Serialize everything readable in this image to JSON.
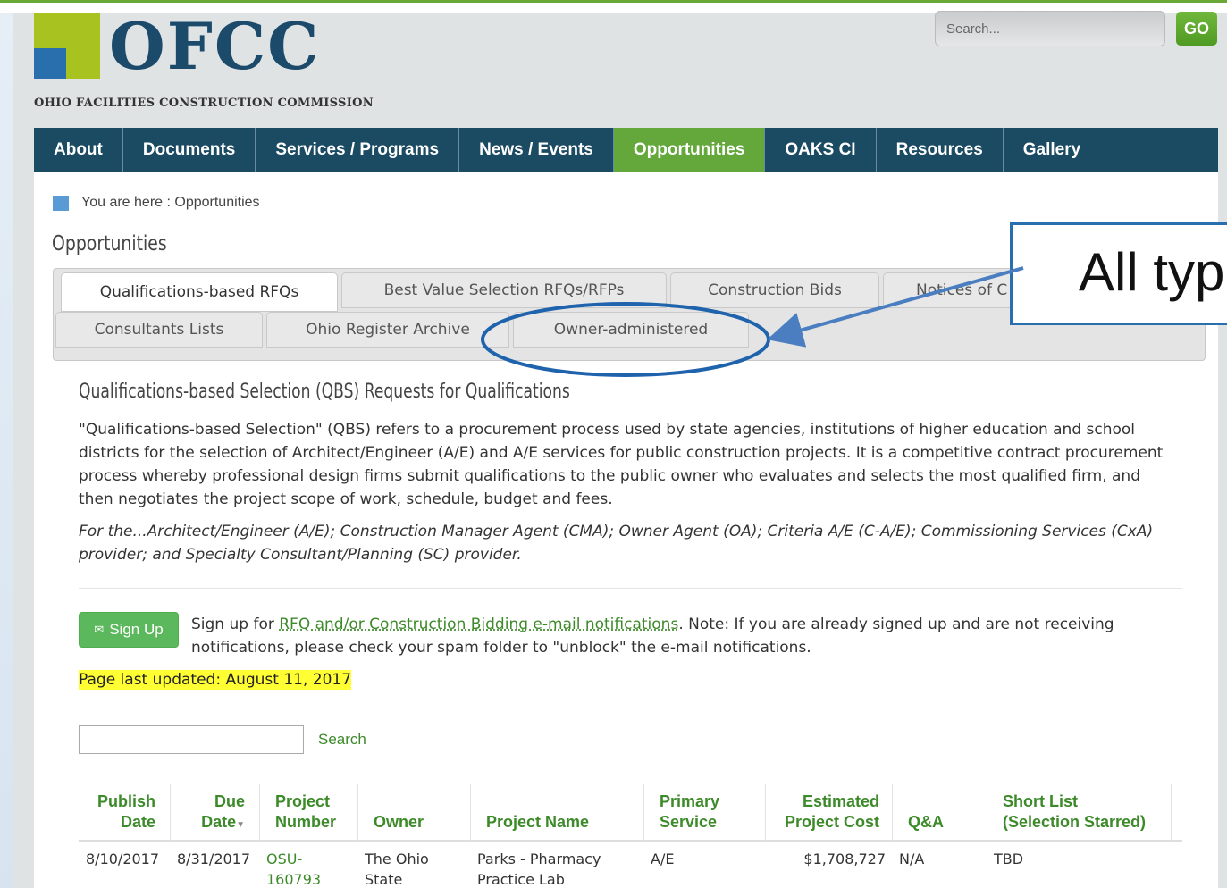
{
  "header": {
    "logo_text": "OFCC",
    "logo_subtitle": "OHIO FACILITIES CONSTRUCTION COMMISSION",
    "search_placeholder": "Search...",
    "search_button": "GO"
  },
  "nav": {
    "items": [
      "About",
      "Documents",
      "Services / Programs",
      "News / Events",
      "Opportunities",
      "OAKS CI",
      "Resources",
      "Gallery"
    ],
    "active": "Opportunities"
  },
  "breadcrumb": "You are here : Opportunities",
  "page_title": "Opportunities",
  "tabs": {
    "row1": [
      "Qualifications-based RFQs",
      "Best Value Selection RFQs/RFPs",
      "Construction Bids",
      "Notices of C"
    ],
    "row2": [
      "Consultants Lists",
      "Ohio Register Archive",
      "Owner-administered"
    ],
    "active": "Qualifications-based RFQs"
  },
  "section": {
    "title": "Qualifications-based Selection (QBS) Requests for Qualifications",
    "paragraph": "\"Qualifications-based Selection\" (QBS) refers to a procurement process used by state agencies, institutions of higher education and school districts for the selection of Architect/Engineer (A/E) and A/E services for public construction projects. It is a competitive contract procurement process whereby professional design firms submit qualifications to the public owner who evaluates and selects the most qualified firm, and then negotiates the project scope of work, schedule, budget and fees.",
    "italic": "For the...Architect/Engineer (A/E); Construction Manager Agent (CMA); Owner Agent (OA); Criteria A/E (C-A/E); Commissioning Services (CxA) provider; and Specialty Consultant/Planning (SC) provider."
  },
  "signup": {
    "button": "Sign Up",
    "text_before": "Sign up for ",
    "link": "RFQ and/or Construction Bidding e-mail notifications",
    "text_after": ". Note: If you are already signed up and are not receiving notifications, please check your spam folder to \"unblock\" the e-mail notifications."
  },
  "last_updated": "Page last updated: August 11, 2017",
  "table_search": {
    "value": "",
    "button": "Search"
  },
  "table": {
    "headers": {
      "publish1": "Publish",
      "publish2": "Date",
      "due1": "Due",
      "due2": "Date",
      "proj1": "Project",
      "proj2": "Number",
      "owner": "Owner",
      "name": "Project Name",
      "service1": "Primary",
      "service2": "Service",
      "cost1": "Estimated",
      "cost2": "Project Cost",
      "qa": "Q&A",
      "short1": "Short List",
      "short2": "(Selection Starred)"
    },
    "rows": [
      {
        "publish": "8/10/2017",
        "due": "8/31/2017",
        "number1": "OSU-",
        "number2": "160793",
        "owner1": "The Ohio",
        "owner2": "State",
        "name1": "Parks - Pharmacy",
        "name2": "Practice Lab",
        "service": "A/E",
        "cost": "$1,708,727",
        "qa": "N/A",
        "short": "TBD"
      }
    ]
  },
  "annotation": {
    "text": "All typ"
  },
  "colors": {
    "nav_bg": "#1b4a63",
    "accent_green": "#64a83c",
    "annotation_blue": "#2a6fad",
    "highlight": "#ffff33"
  }
}
